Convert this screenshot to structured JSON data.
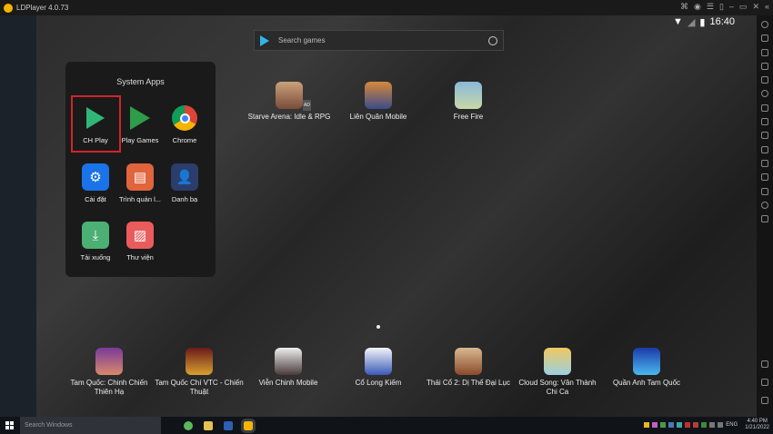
{
  "window": {
    "title": "LDPlayer 4.0.73"
  },
  "status": {
    "time": "16:40"
  },
  "search": {
    "placeholder": "Search games"
  },
  "folder": {
    "title": "System Apps",
    "apps": [
      {
        "label": "CH Play",
        "color": "#1a1a1a"
      },
      {
        "label": "Play Games",
        "color": "#1a1a1a"
      },
      {
        "label": "Chrome",
        "color": "#1a1a1a"
      },
      {
        "label": "Cài đặt",
        "color": "#1a73e8"
      },
      {
        "label": "Trình quản l...",
        "color": "#e0643c"
      },
      {
        "label": "Danh bạ",
        "color": "#2b3d6b"
      },
      {
        "label": "Tải xuống",
        "color": "#4caf73"
      },
      {
        "label": "Thư viện",
        "color": "#ea5b5b"
      }
    ],
    "selected": "CH Play"
  },
  "home_top": [
    {
      "label": "Starve Arena: Idle & RPG",
      "badge": "AD"
    },
    {
      "label": "Liên Quân Mobile"
    },
    {
      "label": "Free Fire"
    }
  ],
  "dock": [
    {
      "label": "Tam Quốc: Chinh Chiến Thiên Hạ"
    },
    {
      "label": "Tam Quốc Chí VTC - Chiến Thuật"
    },
    {
      "label": "Viễn Chinh Mobile"
    },
    {
      "label": "Cổ Long Kiếm"
    },
    {
      "label": "Thái Cổ 2: Dị Thế Đại Lục"
    },
    {
      "label": "Cloud Song: Vân Thành Chi Ca"
    },
    {
      "label": "Quần Anh Tam Quốc"
    }
  ],
  "taskbar": {
    "search_placeholder": "Search Windows",
    "lang": "ENG",
    "time": "4:40 PM",
    "date": "1/21/2022"
  }
}
